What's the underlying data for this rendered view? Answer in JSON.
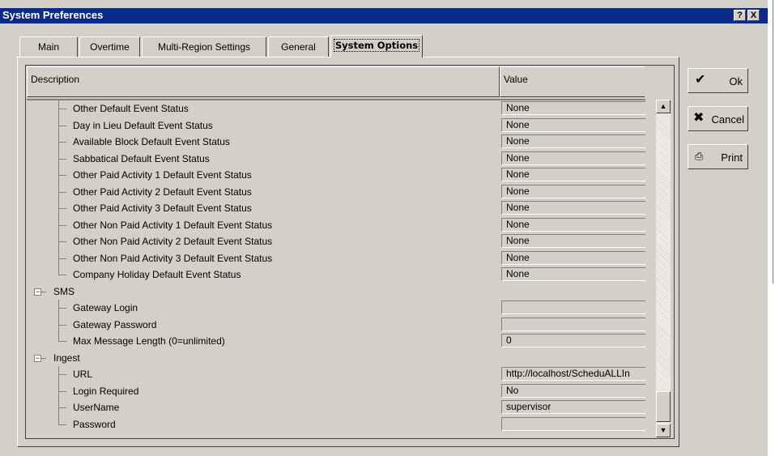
{
  "window": {
    "title": "System Preferences",
    "help_label": "?",
    "close_label": "X"
  },
  "tabs": [
    {
      "label": "Main"
    },
    {
      "label": "Overtime"
    },
    {
      "label": "Multi-Region Settings"
    },
    {
      "label": "General"
    },
    {
      "label": "System Options",
      "active": true
    }
  ],
  "grid": {
    "columns": {
      "description": "Description",
      "value": "Value"
    },
    "rows": [
      {
        "label": "Other Default Event Status",
        "value": "None",
        "level": 1
      },
      {
        "label": "Day in Lieu Default Event Status",
        "value": "None",
        "level": 1
      },
      {
        "label": "Available Block Default Event Status",
        "value": "None",
        "level": 1
      },
      {
        "label": "Sabbatical Default Event Status",
        "value": "None",
        "level": 1
      },
      {
        "label": "Other Paid Activity 1 Default Event Status",
        "value": "None",
        "level": 1
      },
      {
        "label": "Other Paid Activity 2 Default Event Status",
        "value": "None",
        "level": 1
      },
      {
        "label": "Other Paid Activity 3 Default Event Status",
        "value": "None",
        "level": 1
      },
      {
        "label": "Other Non Paid Activity 1 Default Event Status",
        "value": "None",
        "level": 1
      },
      {
        "label": "Other Non Paid Activity 2 Default Event Status",
        "value": "None",
        "level": 1
      },
      {
        "label": "Other Non Paid Activity 3 Default Event Status",
        "value": "None",
        "level": 1
      },
      {
        "label": "Company Holiday Default Event Status",
        "value": "None",
        "level": 1,
        "last": true
      },
      {
        "label": "SMS",
        "level": 0,
        "group": true
      },
      {
        "label": "Gateway Login",
        "value": "",
        "level": 1
      },
      {
        "label": "Gateway Password",
        "value": "",
        "level": 1
      },
      {
        "label": "Max Message Length (0=unlimited)",
        "value": "0",
        "level": 1,
        "last": true
      },
      {
        "label": "Ingest",
        "level": 0,
        "group": true
      },
      {
        "label": "URL",
        "value": "http://localhost/ScheduALLIn",
        "level": 1
      },
      {
        "label": "Login Required",
        "value": "No",
        "level": 1
      },
      {
        "label": "UserName",
        "value": "supervisor",
        "level": 1
      },
      {
        "label": "Password",
        "value": "",
        "level": 1,
        "last": true
      }
    ]
  },
  "buttons": {
    "ok": "Ok",
    "cancel": "Cancel",
    "print": "Print"
  },
  "icons": {
    "ok": "checkmark-icon",
    "cancel": "x-icon",
    "print": "printer-icon",
    "scroll_up": "arrow-up-icon",
    "scroll_down": "arrow-down-icon",
    "collapse": "minus-box-icon"
  }
}
